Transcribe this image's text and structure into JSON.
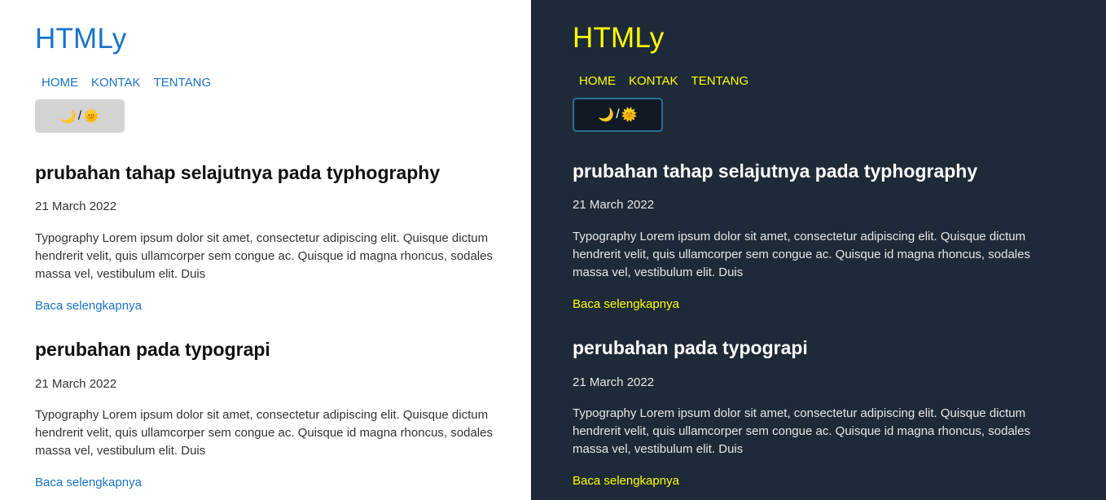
{
  "site": {
    "title": "HTMLy",
    "nav": [
      "HOME",
      "KONTAK",
      "TENTANG"
    ],
    "theme_toggle": {
      "moon": "🌙",
      "separator": "/",
      "sun": "🌞",
      "sun_dark": "🌞"
    }
  },
  "posts": [
    {
      "title": "prubahan tahap selajutnya pada typhography",
      "date": "21 March 2022",
      "excerpt": "Typography Lorem ipsum dolor sit amet, consectetur adipiscing elit. Quisque dictum hendrerit velit, quis ullamcorper sem congue ac. Quisque id magna rhoncus, sodales massa vel, vestibulum elit. Duis",
      "read_more": "Baca selengkapnya"
    },
    {
      "title": "perubahan pada typograpi",
      "date": "21 March 2022",
      "excerpt": "Typography Lorem ipsum dolor sit amet, consectetur adipiscing elit. Quisque dictum hendrerit velit, quis ullamcorper sem congue ac. Quisque id magna rhoncus, sodales massa vel, vestibulum elit. Duis",
      "read_more": "Baca selengkapnya"
    }
  ],
  "colors": {
    "light_background": "#ffffff",
    "light_link": "#1a73c8",
    "light_toggle_bg": "#d3d3d3",
    "dark_background": "#1f2a38",
    "dark_link": "#ffff00",
    "dark_toggle_bg": "#111a24",
    "dark_toggle_border": "#2d6f93"
  }
}
